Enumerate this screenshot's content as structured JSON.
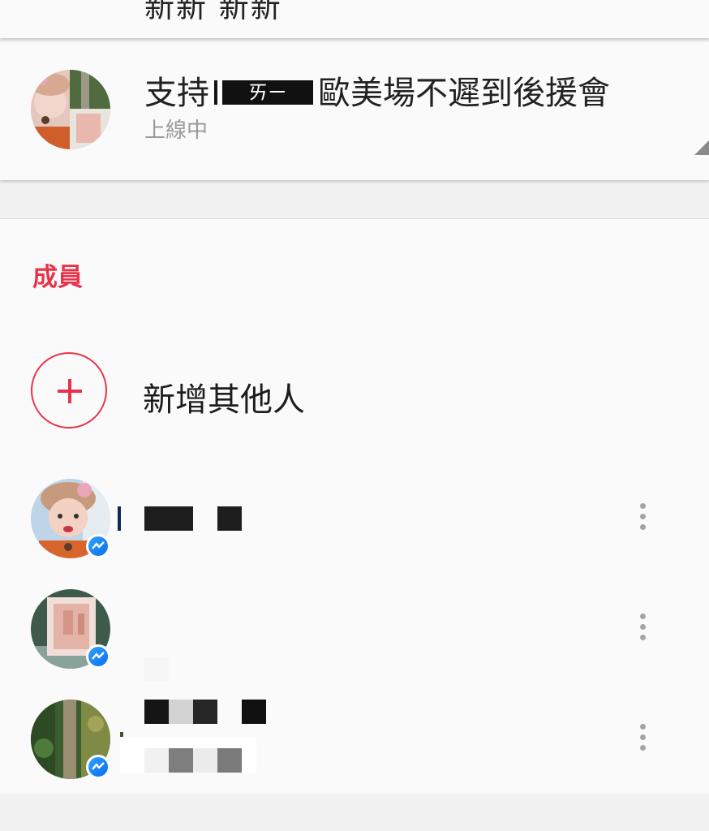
{
  "top_card": {
    "title_partial": "新新  新新"
  },
  "group": {
    "title_prefix": "支持",
    "title_redacted": "ㄞㄧ",
    "title_suffix": "歐美場不遲到後援會",
    "status": "上線中"
  },
  "members_section": {
    "header": "成員",
    "add_label": "新增其他人",
    "members": [
      {
        "name": "",
        "subtitle": "",
        "avatar": "member-photo-1"
      },
      {
        "name": "",
        "subtitle": "",
        "avatar": "member-photo-2"
      },
      {
        "name": "",
        "subtitle": "",
        "avatar": "member-photo-3"
      }
    ]
  },
  "icons": {
    "add": "plus-icon",
    "badge": "messenger-icon",
    "more": "more-vertical-icon"
  },
  "colors": {
    "accent": "#e8334a",
    "messenger": "#0a7cff",
    "background": "#f1f1f1",
    "card": "#fafafa"
  }
}
